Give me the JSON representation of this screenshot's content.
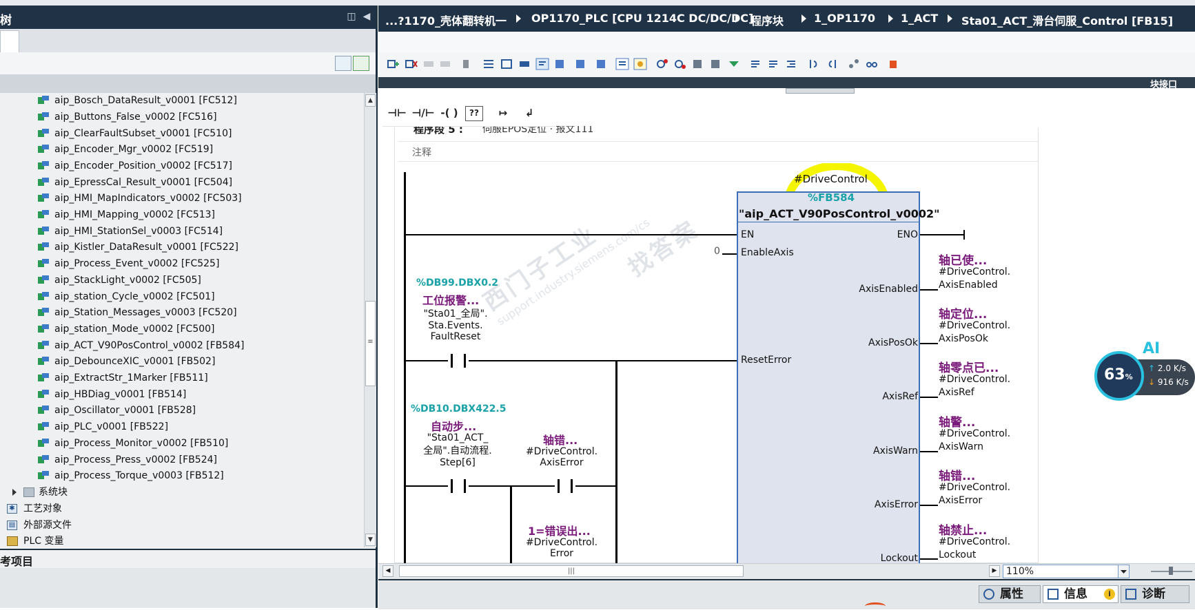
{
  "left_panel": {
    "title": "树",
    "tree_items": [
      {
        "label": "aip_Bosch_DataResult_v0001 [FC512]"
      },
      {
        "label": "aip_Buttons_False_v0002 [FC516]"
      },
      {
        "label": "aip_ClearFaultSubset_v0001 [FC510]"
      },
      {
        "label": "aip_Encoder_Mgr_v0002 [FC519]"
      },
      {
        "label": "aip_Encoder_Position_v0002 [FC517]"
      },
      {
        "label": "aip_EpressCal_Result_v0001 [FC504]"
      },
      {
        "label": "aip_HMI_MapIndicators_v0002 [FC503]"
      },
      {
        "label": "aip_HMI_Mapping_v0002 [FC513]"
      },
      {
        "label": "aip_HMI_StationSel_v0003 [FC514]"
      },
      {
        "label": "aip_Kistler_DataResult_v0001 [FC522]"
      },
      {
        "label": "aip_Process_Event_v0002 [FC525]"
      },
      {
        "label": "aip_StackLight_v0002 [FC505]"
      },
      {
        "label": "aip_station_Cycle_v0002 [FC501]"
      },
      {
        "label": "aip_Station_Messages_v0003 [FC520]"
      },
      {
        "label": "aip_station_Mode_v0002 [FC500]"
      },
      {
        "label": "aip_ACT_V90PosControl_v0002 [FB584]"
      },
      {
        "label": "aip_DebounceXIC_v0001 [FB502]"
      },
      {
        "label": "aip_ExtractStr_1Marker [FB511]"
      },
      {
        "label": "aip_HBDiag_v0001 [FB514]"
      },
      {
        "label": "aip_Oscillator_v0001 [FB528]"
      },
      {
        "label": "aip_PLC_v0001 [FB522]"
      },
      {
        "label": "aip_Process_Monitor_v0002 [FB510]"
      },
      {
        "label": "aip_Process_Press_v0002 [FB524]"
      },
      {
        "label": "aip_Process_Torque_v0003 [FB512]"
      }
    ],
    "folders": {
      "system_blocks": "系统块",
      "tech_objects": "工艺对象",
      "external_sources": "外部源文件",
      "plc_tags": "PLC 变量"
    },
    "reference_projects_title": "考项目"
  },
  "breadcrumb": {
    "items": [
      "...?1170_壳体翻转机一",
      "OP1170_PLC [CPU 1214C DC/DC/DC]",
      "程序块",
      "1_OP1170",
      "1_ACT",
      "Sta01_ACT_滑台伺服_Control [FB15]"
    ]
  },
  "editor": {
    "interface_label": "块接口",
    "network_title": "程序段 5 :",
    "network_desc": "伺服EPOS定位 · 报文111",
    "comment_placeholder": "注释",
    "fb": {
      "instance": "#DriveControl",
      "address": "%FB584",
      "name": "\"aip_ACT_V90PosControl_v0002\"",
      "inputs": {
        "en": "EN",
        "enable_axis": "EnableAxis",
        "enable_axis_value": "0",
        "reset_error": "ResetError"
      },
      "outputs": [
        {
          "pin": "ENO",
          "symbol": "",
          "operand": [
            "",
            ""
          ]
        },
        {
          "pin": "AxisEnabled",
          "symbol": "轴已使...",
          "operand": [
            "#DriveControl.",
            "AxisEnabled"
          ]
        },
        {
          "pin": "AxisPosOk",
          "symbol": "轴定位...",
          "operand": [
            "#DriveControl.",
            "AxisPosOk"
          ]
        },
        {
          "pin": "AxisRef",
          "symbol": "轴零点已...",
          "operand": [
            "#DriveControl.",
            "AxisRef"
          ]
        },
        {
          "pin": "AxisWarn",
          "symbol": "轴警...",
          "operand": [
            "#DriveControl.",
            "AxisWarn"
          ]
        },
        {
          "pin": "AxisError",
          "symbol": "轴错...",
          "operand": [
            "#DriveControl.",
            "AxisError"
          ]
        },
        {
          "pin": "Lockout",
          "symbol": "轴禁止...",
          "operand": [
            "#DriveControl.",
            "Lockout"
          ]
        }
      ]
    },
    "contacts": {
      "c1": {
        "address": "%DB99.DBX0.2",
        "symbol": "工位报警...",
        "operand": [
          "\"Sta01_全局\".",
          "Sta.Events.",
          "FaultReset"
        ]
      },
      "c2": {
        "address": "%DB10.DBX422.5",
        "symbol": "自动步...",
        "operand": [
          "\"Sta01_ACT_",
          "全局\".自动流程.",
          "Step[6]"
        ]
      },
      "c3": {
        "symbol": "轴错...",
        "operand": [
          "#DriveControl.",
          "AxisError"
        ]
      },
      "c4": {
        "symbol": "1=错误出...",
        "operand": [
          "#DriveControl.",
          "Error"
        ]
      }
    },
    "watermark": {
      "line1": "西门子工业",
      "line2": "找答案",
      "line3": "support.industry.siemens.com/cs"
    },
    "zoom": "110%"
  },
  "bottom_tabs": {
    "properties": "属性",
    "info": "信息",
    "diagnostics": "诊断"
  },
  "ai_widget": {
    "label": "AI",
    "percent": "63",
    "percent_unit": "%",
    "up_speed": "2.0",
    "down_speed": "916",
    "unit": "K/s"
  },
  "colors": {
    "title_bar": "#1f3246",
    "highlight": "#f5f500",
    "address": "#1aa2a8",
    "symbol": "#7a1a7a",
    "fb_border": "#3b6fb5"
  }
}
